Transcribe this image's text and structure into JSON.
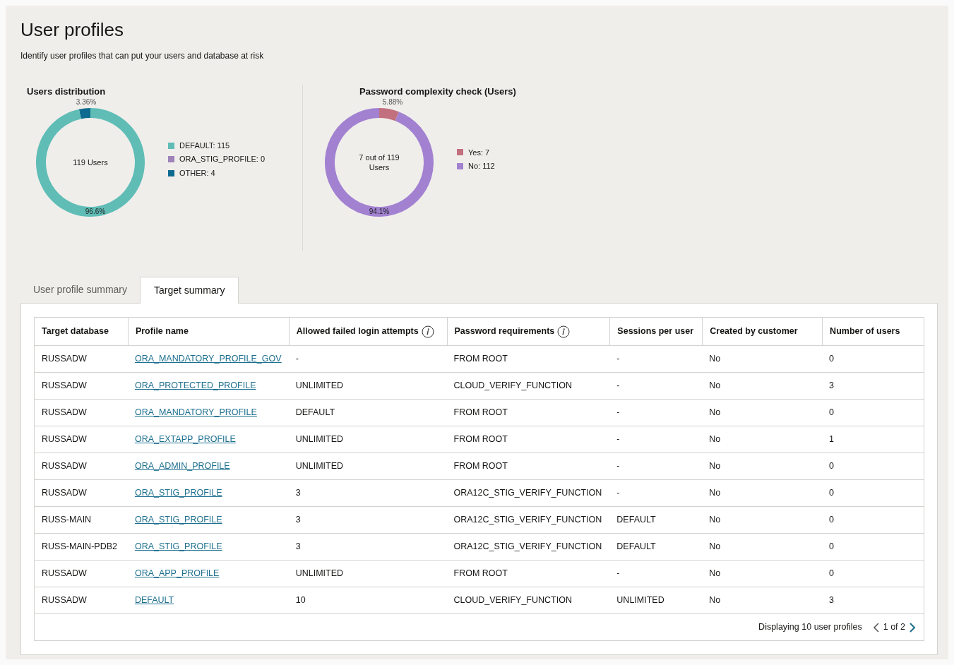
{
  "page": {
    "title": "User profiles",
    "subtitle": "Identify user profiles that can put your users and database at risk"
  },
  "charts": [
    {
      "center_label": [
        "119 Users"
      ],
      "legend": [
        {
          "label": "DEFAULT: 115",
          "color": "#5fbdb6"
        },
        {
          "label": "ORA_STIG_PROFILE: 0",
          "color": "#9e83b8"
        },
        {
          "label": "OTHER: 4",
          "color": "#0e6b8f"
        }
      ],
      "chart_data": {
        "type": "donut",
        "title": "Users distribution",
        "values": [
          96.6,
          0,
          3.36
        ],
        "value_labels": [
          "96.6%",
          null,
          "3.36%"
        ]
      }
    },
    {
      "center_label": [
        "7 out of 119",
        "Users"
      ],
      "legend": [
        {
          "label": "Yes: 7",
          "color": "#c2707e"
        },
        {
          "label": "No: 112",
          "color": "#a281d1"
        }
      ],
      "chart_data": {
        "type": "donut",
        "title": "Password complexity check (Users)",
        "values": [
          5.88,
          94.1
        ],
        "value_labels": [
          "5.88%",
          "94.1%"
        ]
      }
    }
  ],
  "tabs": [
    {
      "label": "User profile summary",
      "selected": false
    },
    {
      "label": "Target summary",
      "selected": true
    }
  ],
  "table": {
    "columns": [
      {
        "label": "Target database"
      },
      {
        "label": "Profile name"
      },
      {
        "label": "Allowed failed login attempts",
        "info": true
      },
      {
        "label": "Password requirements",
        "info": true
      },
      {
        "label": "Sessions per user"
      },
      {
        "label": "Created by customer"
      },
      {
        "label": "Number of users"
      }
    ],
    "rows": [
      [
        "RUSSADW",
        "ORA_MANDATORY_PROFILE_GOV",
        "-",
        "FROM ROOT",
        "-",
        "No",
        "0"
      ],
      [
        "RUSSADW",
        "ORA_PROTECTED_PROFILE",
        "UNLIMITED",
        "CLOUD_VERIFY_FUNCTION",
        "-",
        "No",
        "3"
      ],
      [
        "RUSSADW",
        "ORA_MANDATORY_PROFILE",
        "DEFAULT",
        "FROM ROOT",
        "-",
        "No",
        "0"
      ],
      [
        "RUSSADW",
        "ORA_EXTAPP_PROFILE",
        "UNLIMITED",
        "FROM ROOT",
        "-",
        "No",
        "1"
      ],
      [
        "RUSSADW",
        "ORA_ADMIN_PROFILE",
        "UNLIMITED",
        "FROM ROOT",
        "-",
        "No",
        "0"
      ],
      [
        "RUSSADW",
        "ORA_STIG_PROFILE",
        "3",
        "ORA12C_STIG_VERIFY_FUNCTION",
        "-",
        "No",
        "0"
      ],
      [
        "RUSS-MAIN",
        "ORA_STIG_PROFILE",
        "3",
        "ORA12C_STIG_VERIFY_FUNCTION",
        "DEFAULT",
        "No",
        "0"
      ],
      [
        "RUSS-MAIN-PDB2",
        "ORA_STIG_PROFILE",
        "3",
        "ORA12C_STIG_VERIFY_FUNCTION",
        "DEFAULT",
        "No",
        "0"
      ],
      [
        "RUSSADW",
        "ORA_APP_PROFILE",
        "UNLIMITED",
        "FROM ROOT",
        "-",
        "No",
        "0"
      ],
      [
        "RUSSADW",
        "DEFAULT",
        "10",
        "CLOUD_VERIFY_FUNCTION",
        "UNLIMITED",
        "No",
        "3"
      ]
    ],
    "footer": {
      "summary": "Displaying 10 user profiles",
      "page": "1 of 2"
    }
  }
}
